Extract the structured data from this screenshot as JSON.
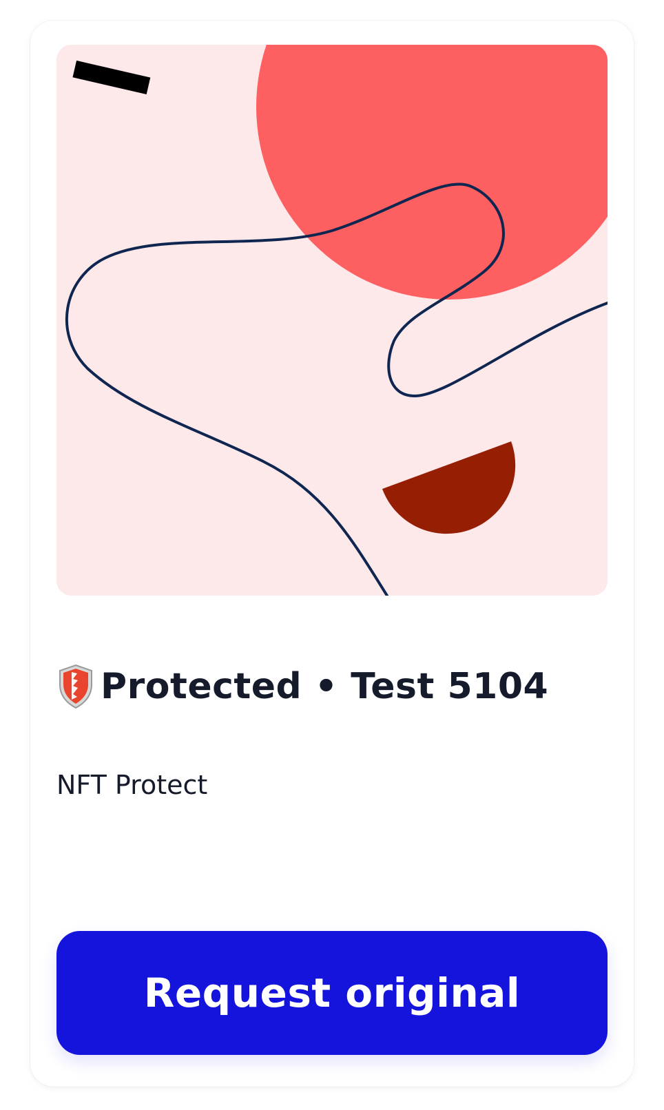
{
  "card": {
    "title": "Protected • Test 5104",
    "collection": "NFT Protect",
    "request_button_label": "Request original",
    "icon": "shield-icon"
  },
  "colors": {
    "artwork_background": "#fde8ea",
    "circle": "#fe5f60",
    "half_disc": "#951e03",
    "curve": "#0f2650",
    "bar": "#000000",
    "button": "#1414dc",
    "text": "#151b2b"
  }
}
